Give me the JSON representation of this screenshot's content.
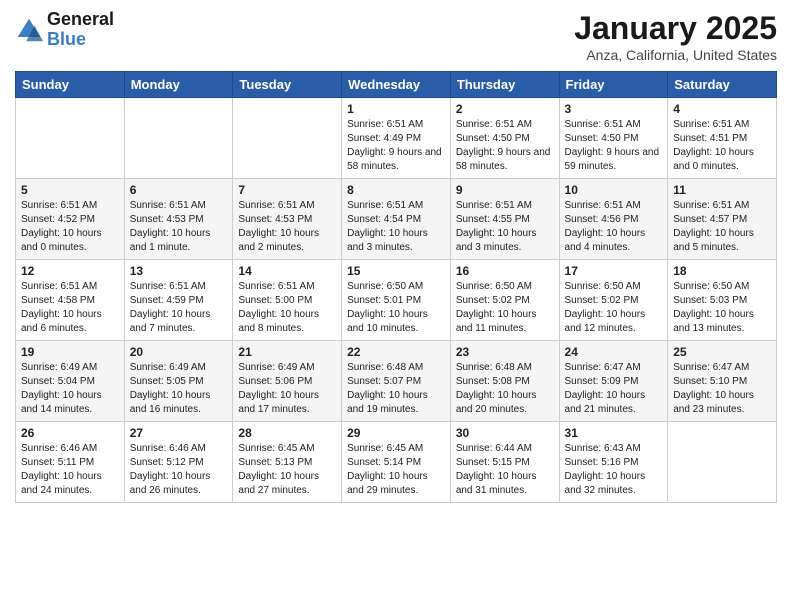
{
  "logo": {
    "name_general": "General",
    "name_blue": "Blue"
  },
  "title": "January 2025",
  "location": "Anza, California, United States",
  "weekdays": [
    "Sunday",
    "Monday",
    "Tuesday",
    "Wednesday",
    "Thursday",
    "Friday",
    "Saturday"
  ],
  "weeks": [
    [
      {
        "day": "",
        "info": ""
      },
      {
        "day": "",
        "info": ""
      },
      {
        "day": "",
        "info": ""
      },
      {
        "day": "1",
        "info": "Sunrise: 6:51 AM\nSunset: 4:49 PM\nDaylight: 9 hours and 58 minutes."
      },
      {
        "day": "2",
        "info": "Sunrise: 6:51 AM\nSunset: 4:50 PM\nDaylight: 9 hours and 58 minutes."
      },
      {
        "day": "3",
        "info": "Sunrise: 6:51 AM\nSunset: 4:50 PM\nDaylight: 9 hours and 59 minutes."
      },
      {
        "day": "4",
        "info": "Sunrise: 6:51 AM\nSunset: 4:51 PM\nDaylight: 10 hours and 0 minutes."
      }
    ],
    [
      {
        "day": "5",
        "info": "Sunrise: 6:51 AM\nSunset: 4:52 PM\nDaylight: 10 hours and 0 minutes."
      },
      {
        "day": "6",
        "info": "Sunrise: 6:51 AM\nSunset: 4:53 PM\nDaylight: 10 hours and 1 minute."
      },
      {
        "day": "7",
        "info": "Sunrise: 6:51 AM\nSunset: 4:53 PM\nDaylight: 10 hours and 2 minutes."
      },
      {
        "day": "8",
        "info": "Sunrise: 6:51 AM\nSunset: 4:54 PM\nDaylight: 10 hours and 3 minutes."
      },
      {
        "day": "9",
        "info": "Sunrise: 6:51 AM\nSunset: 4:55 PM\nDaylight: 10 hours and 3 minutes."
      },
      {
        "day": "10",
        "info": "Sunrise: 6:51 AM\nSunset: 4:56 PM\nDaylight: 10 hours and 4 minutes."
      },
      {
        "day": "11",
        "info": "Sunrise: 6:51 AM\nSunset: 4:57 PM\nDaylight: 10 hours and 5 minutes."
      }
    ],
    [
      {
        "day": "12",
        "info": "Sunrise: 6:51 AM\nSunset: 4:58 PM\nDaylight: 10 hours and 6 minutes."
      },
      {
        "day": "13",
        "info": "Sunrise: 6:51 AM\nSunset: 4:59 PM\nDaylight: 10 hours and 7 minutes."
      },
      {
        "day": "14",
        "info": "Sunrise: 6:51 AM\nSunset: 5:00 PM\nDaylight: 10 hours and 8 minutes."
      },
      {
        "day": "15",
        "info": "Sunrise: 6:50 AM\nSunset: 5:01 PM\nDaylight: 10 hours and 10 minutes."
      },
      {
        "day": "16",
        "info": "Sunrise: 6:50 AM\nSunset: 5:02 PM\nDaylight: 10 hours and 11 minutes."
      },
      {
        "day": "17",
        "info": "Sunrise: 6:50 AM\nSunset: 5:02 PM\nDaylight: 10 hours and 12 minutes."
      },
      {
        "day": "18",
        "info": "Sunrise: 6:50 AM\nSunset: 5:03 PM\nDaylight: 10 hours and 13 minutes."
      }
    ],
    [
      {
        "day": "19",
        "info": "Sunrise: 6:49 AM\nSunset: 5:04 PM\nDaylight: 10 hours and 14 minutes."
      },
      {
        "day": "20",
        "info": "Sunrise: 6:49 AM\nSunset: 5:05 PM\nDaylight: 10 hours and 16 minutes."
      },
      {
        "day": "21",
        "info": "Sunrise: 6:49 AM\nSunset: 5:06 PM\nDaylight: 10 hours and 17 minutes."
      },
      {
        "day": "22",
        "info": "Sunrise: 6:48 AM\nSunset: 5:07 PM\nDaylight: 10 hours and 19 minutes."
      },
      {
        "day": "23",
        "info": "Sunrise: 6:48 AM\nSunset: 5:08 PM\nDaylight: 10 hours and 20 minutes."
      },
      {
        "day": "24",
        "info": "Sunrise: 6:47 AM\nSunset: 5:09 PM\nDaylight: 10 hours and 21 minutes."
      },
      {
        "day": "25",
        "info": "Sunrise: 6:47 AM\nSunset: 5:10 PM\nDaylight: 10 hours and 23 minutes."
      }
    ],
    [
      {
        "day": "26",
        "info": "Sunrise: 6:46 AM\nSunset: 5:11 PM\nDaylight: 10 hours and 24 minutes."
      },
      {
        "day": "27",
        "info": "Sunrise: 6:46 AM\nSunset: 5:12 PM\nDaylight: 10 hours and 26 minutes."
      },
      {
        "day": "28",
        "info": "Sunrise: 6:45 AM\nSunset: 5:13 PM\nDaylight: 10 hours and 27 minutes."
      },
      {
        "day": "29",
        "info": "Sunrise: 6:45 AM\nSunset: 5:14 PM\nDaylight: 10 hours and 29 minutes."
      },
      {
        "day": "30",
        "info": "Sunrise: 6:44 AM\nSunset: 5:15 PM\nDaylight: 10 hours and 31 minutes."
      },
      {
        "day": "31",
        "info": "Sunrise: 6:43 AM\nSunset: 5:16 PM\nDaylight: 10 hours and 32 minutes."
      },
      {
        "day": "",
        "info": ""
      }
    ]
  ]
}
